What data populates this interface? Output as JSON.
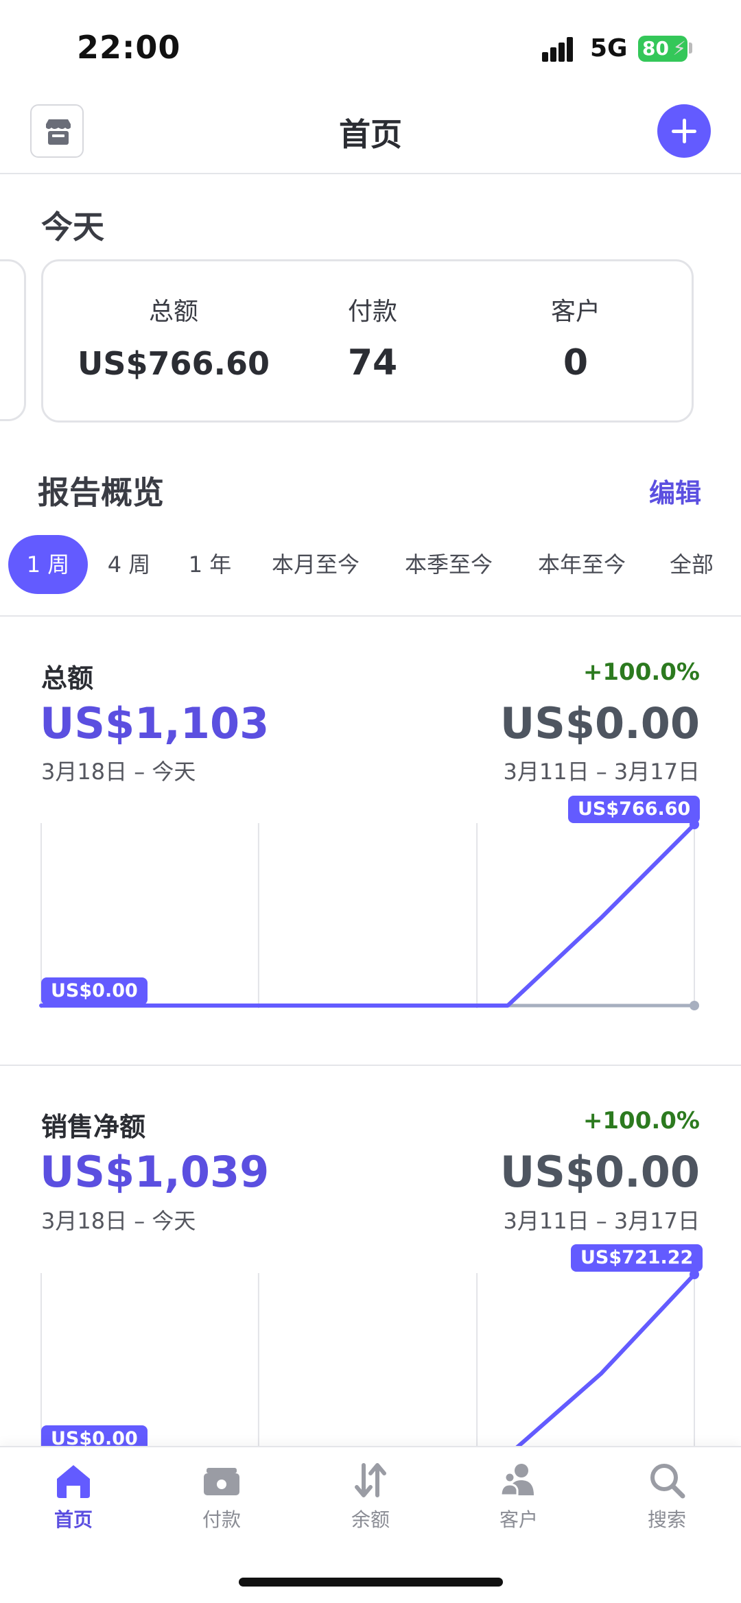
{
  "status_bar": {
    "time": "22:00",
    "network": "5G",
    "battery": "80"
  },
  "header": {
    "title": "首页"
  },
  "today": {
    "title": "今天",
    "stats": [
      {
        "label": "总额",
        "value": "US$766.60"
      },
      {
        "label": "付款",
        "value": "74"
      },
      {
        "label": "客户",
        "value": "0"
      }
    ]
  },
  "report": {
    "title": "报告概览",
    "edit_label": "编辑",
    "tabs": [
      "1 周",
      "4 周",
      "1 年",
      "本月至今",
      "本季至今",
      "本年至今",
      "全部"
    ],
    "active_tab": "1 周"
  },
  "metrics": [
    {
      "title": "总额",
      "change": "+100.0%",
      "value": "US$1,103",
      "previous_value": "US$0.00",
      "range": "3月18日 – 今天",
      "previous_range": "3月11日 – 3月17日",
      "start_label": "US$0.00",
      "end_label": "US$766.60"
    },
    {
      "title": "销售净额",
      "change": "+100.0%",
      "value": "US$1,039",
      "previous_value": "US$0.00",
      "range": "3月18日 – 今天",
      "previous_range": "3月11日 – 3月17日",
      "start_label": "US$0.00",
      "end_label": "US$721.22"
    }
  ],
  "chart_data": [
    {
      "type": "line",
      "title": "总额",
      "series": [
        {
          "values": [
            0,
            0,
            0,
            0,
            0,
            0,
            371,
            766.6
          ]
        },
        {
          "values": [
            0,
            0,
            0,
            0,
            0,
            0,
            0,
            0
          ]
        }
      ],
      "ylim": [
        0,
        766.6
      ],
      "grid": true
    },
    {
      "type": "line",
      "title": "销售净额",
      "series": [
        {
          "values": [
            0,
            0,
            0,
            0,
            0,
            0,
            326,
            721.22
          ]
        },
        {
          "values": [
            0,
            0,
            0,
            0,
            0,
            0,
            0,
            0
          ]
        }
      ],
      "ylim": [
        0,
        721.22
      ],
      "grid": true
    }
  ],
  "nav": {
    "items": [
      {
        "label": "首页",
        "icon": "home-icon",
        "active": true
      },
      {
        "label": "付款",
        "icon": "payments-icon",
        "active": false
      },
      {
        "label": "余额",
        "icon": "balance-icon",
        "active": false
      },
      {
        "label": "客户",
        "icon": "customers-icon",
        "active": false
      },
      {
        "label": "搜索",
        "icon": "search-icon",
        "active": false
      }
    ]
  },
  "colors": {
    "accent": "#635bff",
    "positive": "#2c7a1f",
    "compare_line": "#a7afbf"
  }
}
